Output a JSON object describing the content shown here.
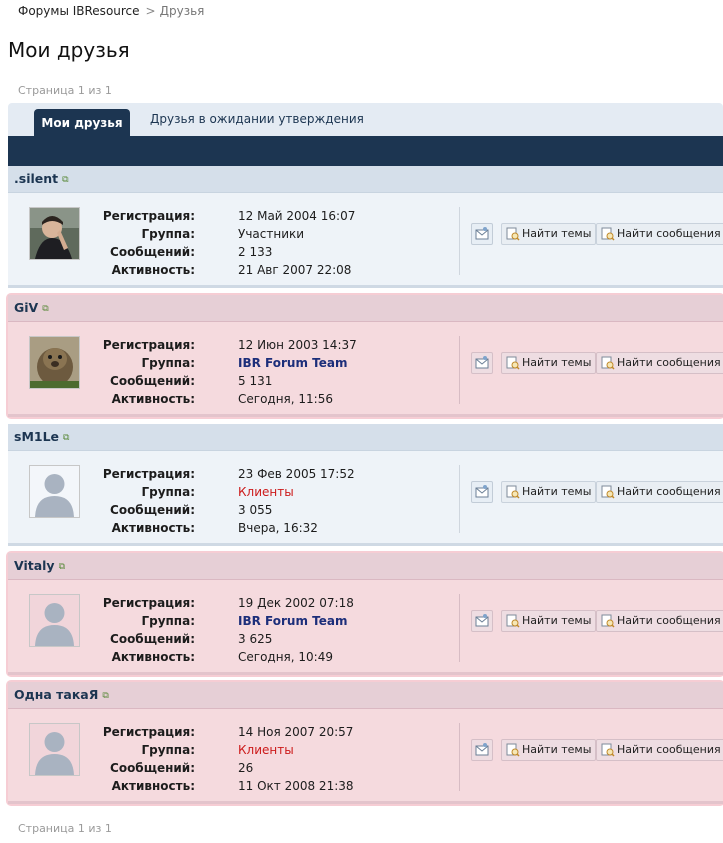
{
  "breadcrumb": {
    "root": "Форумы IBResource",
    "separator": ">",
    "current": "Друзья"
  },
  "page_title": "Мои друзья",
  "pager": {
    "text": "Страница 1 из 1"
  },
  "tabs": {
    "active": "Мои друзья",
    "pending": "Друзья в ожидании утверждения"
  },
  "labels": {
    "reg": "Регистрация:",
    "group": "Группа:",
    "posts": "Сообщений:",
    "activity": "Активность:",
    "find_topics": "Найти темы",
    "find_posts": "Найти сообщения"
  },
  "friends": [
    {
      "name": ".silent",
      "reg": "12 Май 2004 16:07",
      "group": "Участники",
      "posts": "2 133",
      "activity": "21 Авг 2007 22:08"
    },
    {
      "name": "GiV",
      "reg": "12 Июн 2003 14:37",
      "group": "IBR Forum Team",
      "posts": "5 131",
      "activity": "Сегодня, 11:56"
    },
    {
      "name": "sM1Le",
      "reg": "23 Фев 2005 17:52",
      "group": "Клиенты",
      "posts": "3 055",
      "activity": "Вчера, 16:32"
    },
    {
      "name": "Vitaly",
      "reg": "19 Дек 2002 07:18",
      "group": "IBR Forum Team",
      "posts": "3 625",
      "activity": "Сегодня, 10:49"
    },
    {
      "name": "Одна такаЯ",
      "reg": "14 Ноя 2007 20:57",
      "group": "Клиенты",
      "posts": "26",
      "activity": "11 Окт 2008 21:38"
    }
  ],
  "colors": {
    "accent": "#1c3551",
    "team": "#1c2e7a",
    "client": "#cc1a1a",
    "pending_bg": "#f5dade",
    "normal_bg": "#eef3f8"
  },
  "icons": {
    "mail": "envelope-icon",
    "search": "search-doc-icon",
    "external": "external-link-icon"
  }
}
